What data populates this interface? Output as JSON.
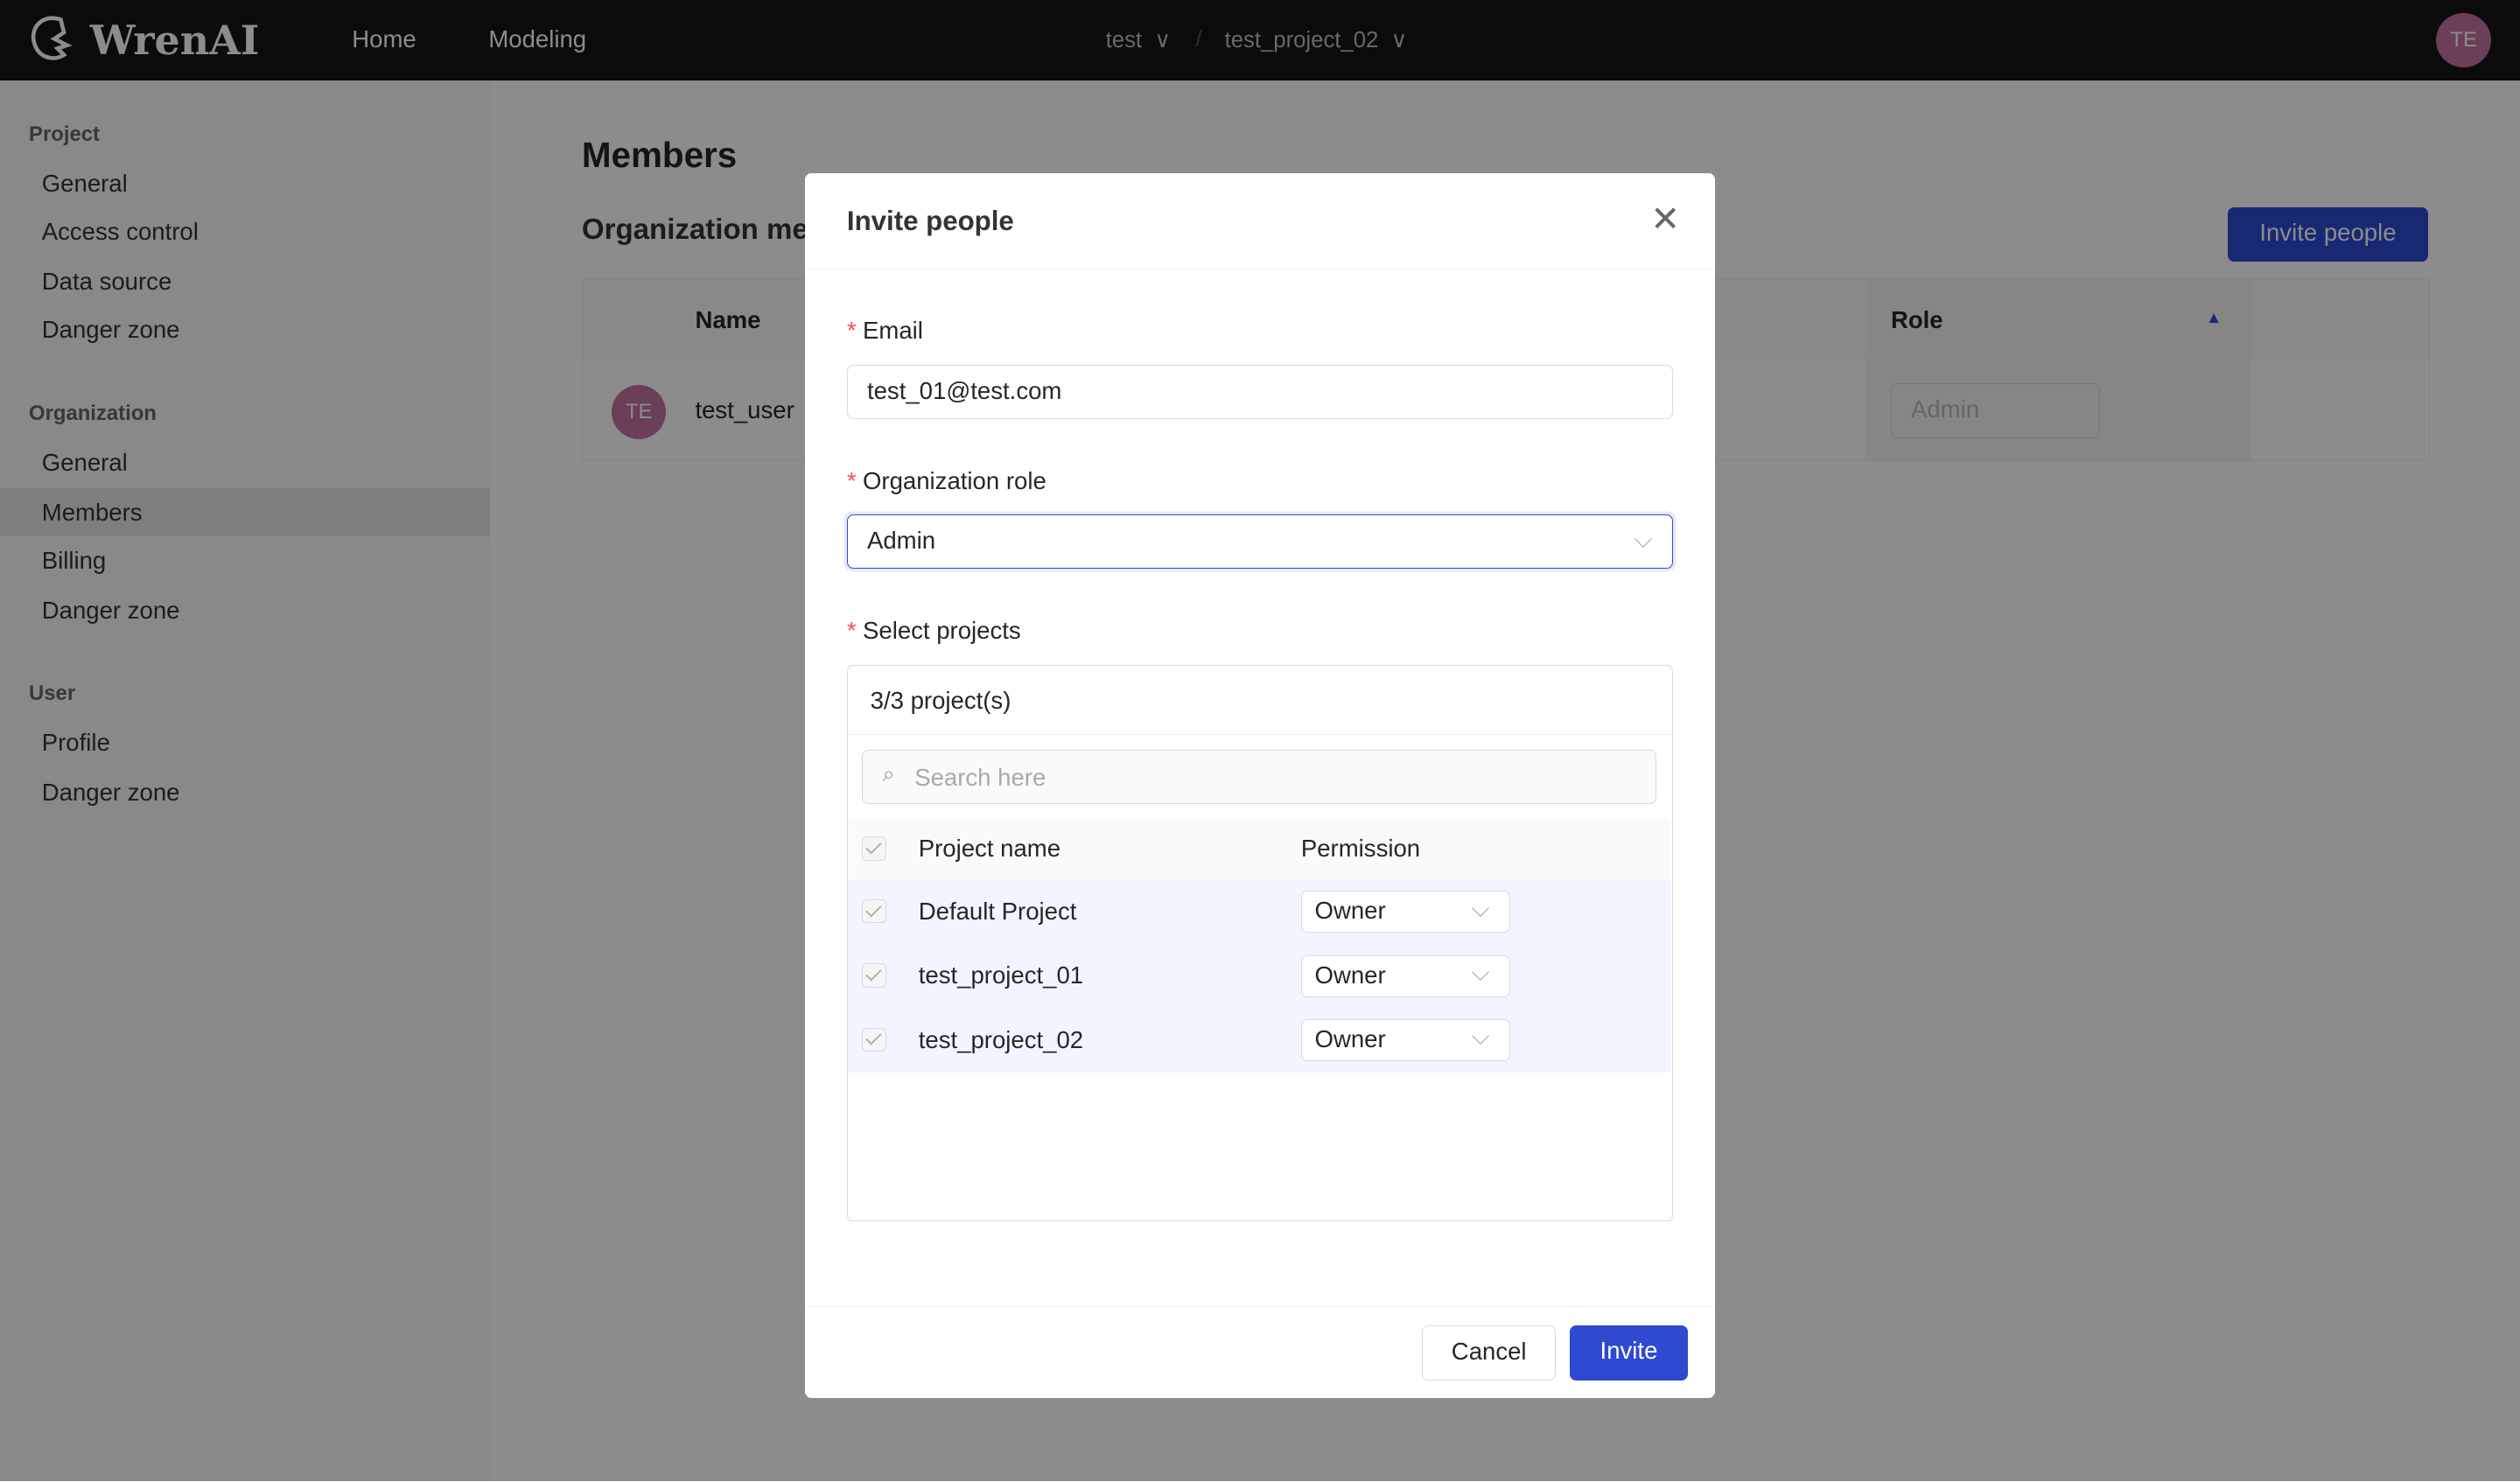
{
  "header": {
    "logo": "WrenAI",
    "nav": [
      "Home",
      "Modeling"
    ],
    "org": "test",
    "project": "test_project_02",
    "avatar": "TE"
  },
  "sidebar": {
    "groups": [
      {
        "title": "Project",
        "items": [
          "General",
          "Access control",
          "Data source",
          "Danger zone"
        ]
      },
      {
        "title": "Organization",
        "items": [
          "General",
          "Members",
          "Billing",
          "Danger zone"
        ]
      },
      {
        "title": "User",
        "items": [
          "Profile",
          "Danger zone"
        ]
      }
    ],
    "active": "Members"
  },
  "main": {
    "title": "Members",
    "subtitle": "Organization members",
    "invite_button": "Invite people",
    "table": {
      "columns": [
        "Name",
        "Role"
      ],
      "rows": [
        {
          "avatar": "TE",
          "name": "test_user",
          "role": "Admin"
        }
      ]
    }
  },
  "modal": {
    "title": "Invite people",
    "email_label": "Email",
    "email_value": "test_01@test.com",
    "role_label": "Organization role",
    "role_value": "Admin",
    "projects_label": "Select projects",
    "projects_count": "3/3 project(s)",
    "search_placeholder": "Search here",
    "columns": [
      "Project name",
      "Permission"
    ],
    "projects": [
      {
        "name": "Default Project",
        "permission": "Owner"
      },
      {
        "name": "test_project_01",
        "permission": "Owner"
      },
      {
        "name": "test_project_02",
        "permission": "Owner"
      }
    ],
    "cancel": "Cancel",
    "invite": "Invite"
  },
  "colors": {
    "primary": "#2f49d1",
    "header": "#141414",
    "required": "#ff4d4f"
  }
}
